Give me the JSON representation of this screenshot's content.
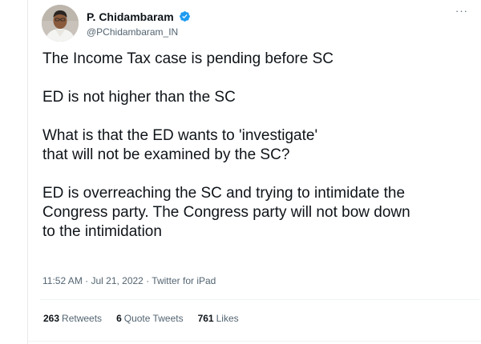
{
  "author": {
    "display_name": "P. Chidambaram",
    "handle": "@PChidambaram_IN",
    "verified": true
  },
  "more_menu": "···",
  "tweet": {
    "text": "The Income Tax case is pending before SC\n\nED is not higher than the SC\n\nWhat is that the ED wants to 'investigate'\nthat will not be examined by the SC?\n\nED is overreaching the SC and trying to intimidate the\nCongress party. The Congress party will not bow down\nto the intimidation",
    "meta": "11:52 AM · Jul 21, 2022 · Twitter for iPad"
  },
  "stats": [
    {
      "count": "263",
      "label": "Retweets"
    },
    {
      "count": "6",
      "label": "Quote Tweets"
    },
    {
      "count": "761",
      "label": "Likes"
    }
  ],
  "colors": {
    "verified_badge": "#1d9bf0",
    "secondary_text": "#536471",
    "primary_text": "#0f1419"
  }
}
